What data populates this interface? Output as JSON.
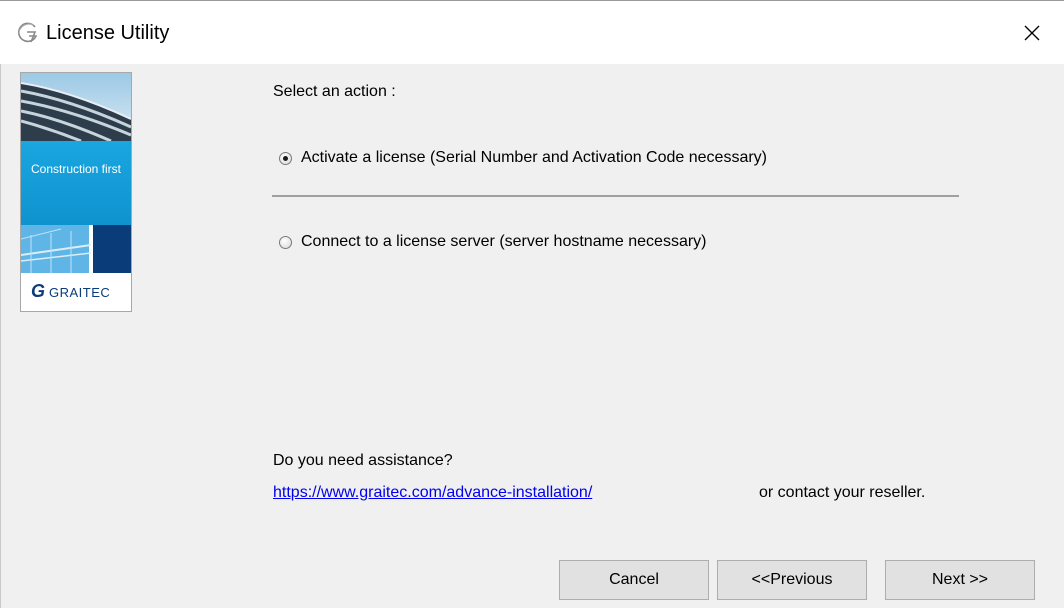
{
  "window": {
    "title": "License Utility",
    "close_label": "✕"
  },
  "banner": {
    "tagline": "Construction first",
    "logo_g": "G",
    "logo_text": "GRAITEC"
  },
  "main": {
    "prompt": "Select an action :",
    "options": [
      {
        "label": "Activate a license (Serial Number and Activation Code necessary)",
        "selected": true
      },
      {
        "label": "Connect to a license server (server hostname necessary)",
        "selected": false
      }
    ],
    "assistance": {
      "question": "Do you need assistance?",
      "link_text": "https://www.graitec.com/advance-installation/",
      "suffix": "or contact your reseller."
    }
  },
  "buttons": {
    "cancel": "Cancel",
    "previous": "<<Previous",
    "next": "Next >>"
  },
  "colors": {
    "banner_blue": "#1aa6e0",
    "dark_blue": "#0a3c7a",
    "link": "#0000ee"
  }
}
